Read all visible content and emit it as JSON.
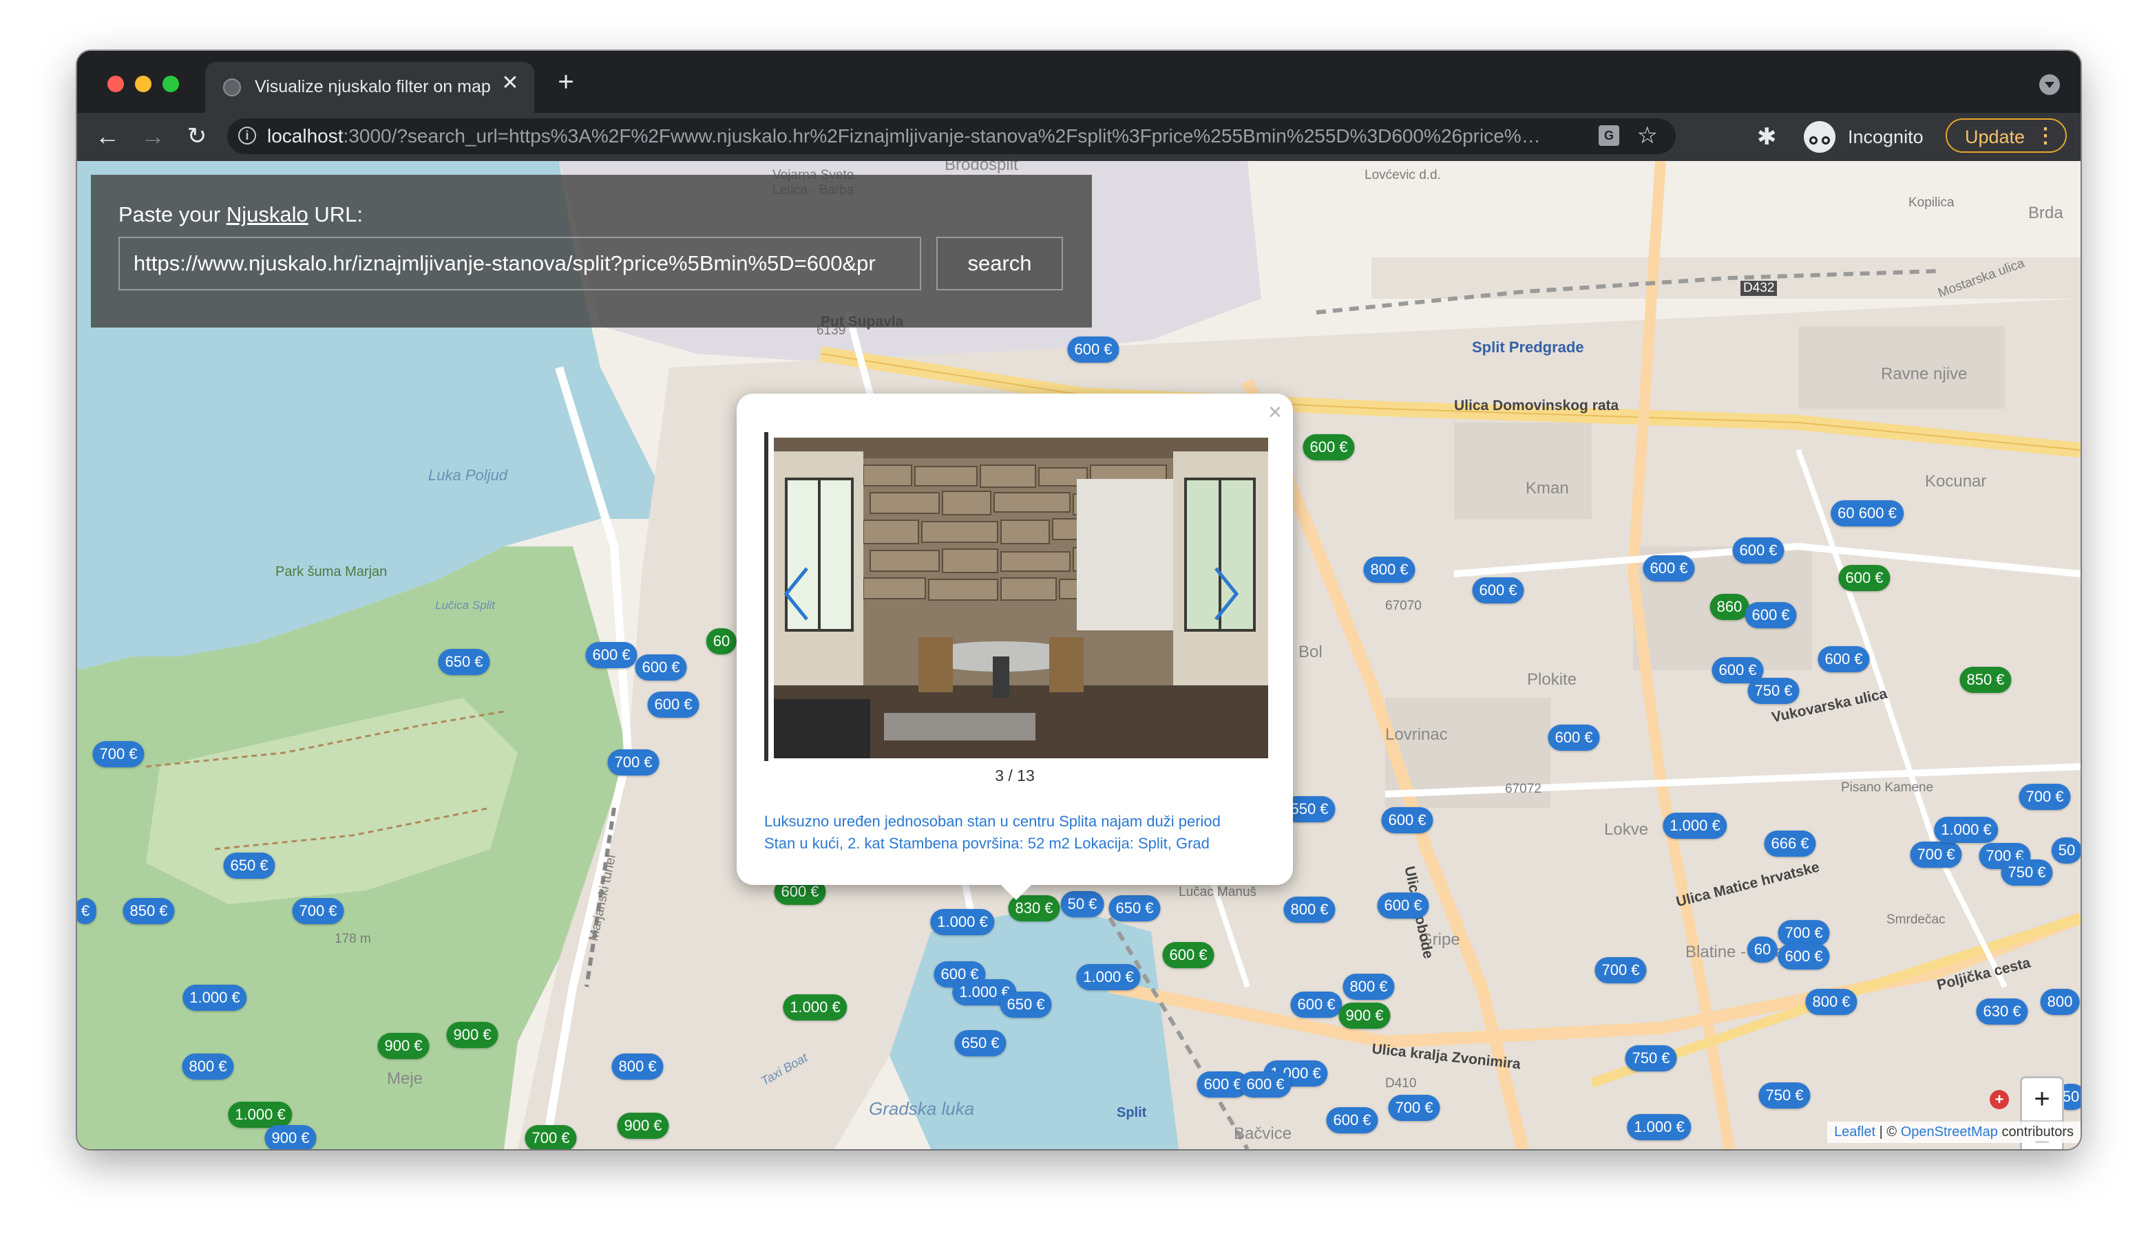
{
  "browser": {
    "tab_title": "Visualize njuskalo filter on map",
    "tab_close": "✕",
    "new_tab": "+",
    "url_host": "localhost",
    "url_rest": ":3000/?search_url=https%3A%2F%2Fwww.njuskalo.hr%2Fiznajmljivanje-stanova%2Fsplit%3Fprice%255Bmin%255D%3D600%26price%…",
    "incognito_label": "Incognito",
    "update_label": "Update",
    "icons": [
      "back-icon",
      "forward-icon",
      "reload-icon",
      "info-icon",
      "translate-icon",
      "star-icon",
      "extensions-icon",
      "incognito-icon",
      "menu-icon"
    ]
  },
  "search": {
    "label_prefix": "Paste your ",
    "label_link": "Njuskalo",
    "label_suffix": " URL:",
    "input_value": "https://www.njuskalo.hr/iznajmljivanje-stanova/split?price%5Bmin%5D=600&pr",
    "button_label": "search"
  },
  "popup": {
    "counter": "3 / 13",
    "description_line1": "Luksuzno uređen jednosoban stan u centru Splita najam duži period",
    "description_line2": "Stan u kući, 2. kat Stambena površina: 52 m2 Lokacija: Split, Grad",
    "close": "×"
  },
  "map_labels": [
    "Brodosplit",
    "Vojarna Sveto Letica - Barba",
    "Lovćevic d.d.",
    "Kopilica",
    "Brda",
    "Put Supavla",
    "Luka Poljud",
    "Park šuma Marjan",
    "Lučica Split",
    "Split Predgrade",
    "Ulica Domovinskog rata",
    "Ravne njive",
    "Kman",
    "Kocunar",
    "Bol",
    "Plokite",
    "Lovrinac",
    "Lokve",
    "Pisano Kamene",
    "Marjanski tunel",
    "Meje",
    "Taxi Boat",
    "Gradska luka",
    "Lučac Manuš",
    "Gripe",
    "Split",
    "Bačvice",
    "Blatine - Škrape",
    "Smrdečac",
    "Poljička cesta",
    "Ulica kralja Zvonimira",
    "Vukovarska ulica",
    "Mostarska ulica",
    "Ulica Matice hrvatske",
    "Ulica slobode",
    "6139",
    "67070",
    "67072",
    "D432",
    "D410",
    "178 m"
  ],
  "markers": [
    {
      "label": "600 €",
      "color": "blue"
    },
    {
      "label": "600 €",
      "color": "green"
    },
    {
      "label": "650 €",
      "color": "blue"
    },
    {
      "label": "600 €",
      "color": "blue"
    },
    {
      "label": "600 €",
      "color": "blue"
    },
    {
      "label": "600 €",
      "color": "blue"
    },
    {
      "label": "60",
      "color": "green"
    },
    {
      "label": "700 €",
      "color": "blue"
    },
    {
      "label": "700 €",
      "color": "blue"
    },
    {
      "label": "650 €",
      "color": "blue"
    },
    {
      "label": "850 €",
      "color": "blue"
    },
    {
      "label": "700 €",
      "color": "blue"
    },
    {
      "label": "€",
      "color": "blue"
    },
    {
      "label": "1.000 €",
      "color": "blue"
    },
    {
      "label": "900 €",
      "color": "green"
    },
    {
      "label": "900 €",
      "color": "green"
    },
    {
      "label": "800 €",
      "color": "blue"
    },
    {
      "label": "1.000 €",
      "color": "green"
    },
    {
      "label": "900 €",
      "color": "blue"
    },
    {
      "label": "800 €",
      "color": "blue"
    },
    {
      "label": "900 €",
      "color": "green"
    },
    {
      "label": "700 €",
      "color": "green"
    },
    {
      "label": "1.000 €",
      "color": "green"
    },
    {
      "label": "600 €",
      "color": "green"
    },
    {
      "label": "1.000 €",
      "color": "blue"
    },
    {
      "label": "830 €",
      "color": "green"
    },
    {
      "label": "50 €",
      "color": "blue"
    },
    {
      "label": "650 €",
      "color": "blue"
    },
    {
      "label": "600 €",
      "color": "blue"
    },
    {
      "label": "1.000 €",
      "color": "blue"
    },
    {
      "label": "650 €",
      "color": "blue"
    },
    {
      "label": "1.000 €",
      "color": "blue"
    },
    {
      "label": "650 €",
      "color": "blue"
    },
    {
      "label": "600 €",
      "color": "green"
    },
    {
      "label": "800 €",
      "color": "blue"
    },
    {
      "label": "600 €",
      "color": "blue"
    },
    {
      "label": "800 €",
      "color": "blue"
    },
    {
      "label": "600 €",
      "color": "blue"
    },
    {
      "label": "900 €",
      "color": "green"
    },
    {
      "label": "1.000 €",
      "color": "blue"
    },
    {
      "label": "600 €",
      "color": "blue"
    },
    {
      "label": "600 €",
      "color": "blue"
    },
    {
      "label": "600 €",
      "color": "blue"
    },
    {
      "label": "700 €",
      "color": "blue"
    },
    {
      "label": "800 €",
      "color": "blue"
    },
    {
      "label": "600 €",
      "color": "blue"
    },
    {
      "label": "600 €",
      "color": "blue"
    },
    {
      "label": "600 €",
      "color": "blue"
    },
    {
      "label": "860",
      "color": "green"
    },
    {
      "label": "600 €",
      "color": "blue"
    },
    {
      "label": "600 €",
      "color": "blue"
    },
    {
      "label": "750 €",
      "color": "blue"
    },
    {
      "label": "600 €",
      "color": "blue"
    },
    {
      "label": "600 €",
      "color": "blue"
    },
    {
      "label": "60 600 €",
      "color": "blue"
    },
    {
      "label": "600 €",
      "color": "green"
    },
    {
      "label": "850 €",
      "color": "green"
    },
    {
      "label": "600 €",
      "color": "blue"
    },
    {
      "label": "1.000 €",
      "color": "blue"
    },
    {
      "label": "666 €",
      "color": "blue"
    },
    {
      "label": "700 €",
      "color": "blue"
    },
    {
      "label": "700 €",
      "color": "blue"
    },
    {
      "label": "60",
      "color": "blue"
    },
    {
      "label": "600 €",
      "color": "blue"
    },
    {
      "label": "700 €",
      "color": "blue"
    },
    {
      "label": "750 €",
      "color": "blue"
    },
    {
      "label": "750 €",
      "color": "blue"
    },
    {
      "label": "1.000 €",
      "color": "blue"
    },
    {
      "label": "800 €",
      "color": "blue"
    },
    {
      "label": "1.000 €",
      "color": "blue"
    },
    {
      "label": "700 €",
      "color": "blue"
    },
    {
      "label": "750 €",
      "color": "blue"
    },
    {
      "label": "50",
      "color": "blue"
    },
    {
      "label": "700 €",
      "color": "blue"
    },
    {
      "label": "630 €",
      "color": "blue"
    },
    {
      "label": "800",
      "color": "blue"
    },
    {
      "label": "50",
      "color": "blue"
    },
    {
      "label": "550 €",
      "color": "blue"
    }
  ],
  "zoom": {
    "in": "+",
    "out": "−"
  },
  "attribution": {
    "leaflet": "Leaflet",
    "sep": " | © ",
    "osm": "OpenStreetMap",
    "suffix": " contributors"
  },
  "colors": {
    "marker_blue": "#2b78d1",
    "marker_green": "#1c8a2a",
    "update_border": "#e5a72a"
  }
}
